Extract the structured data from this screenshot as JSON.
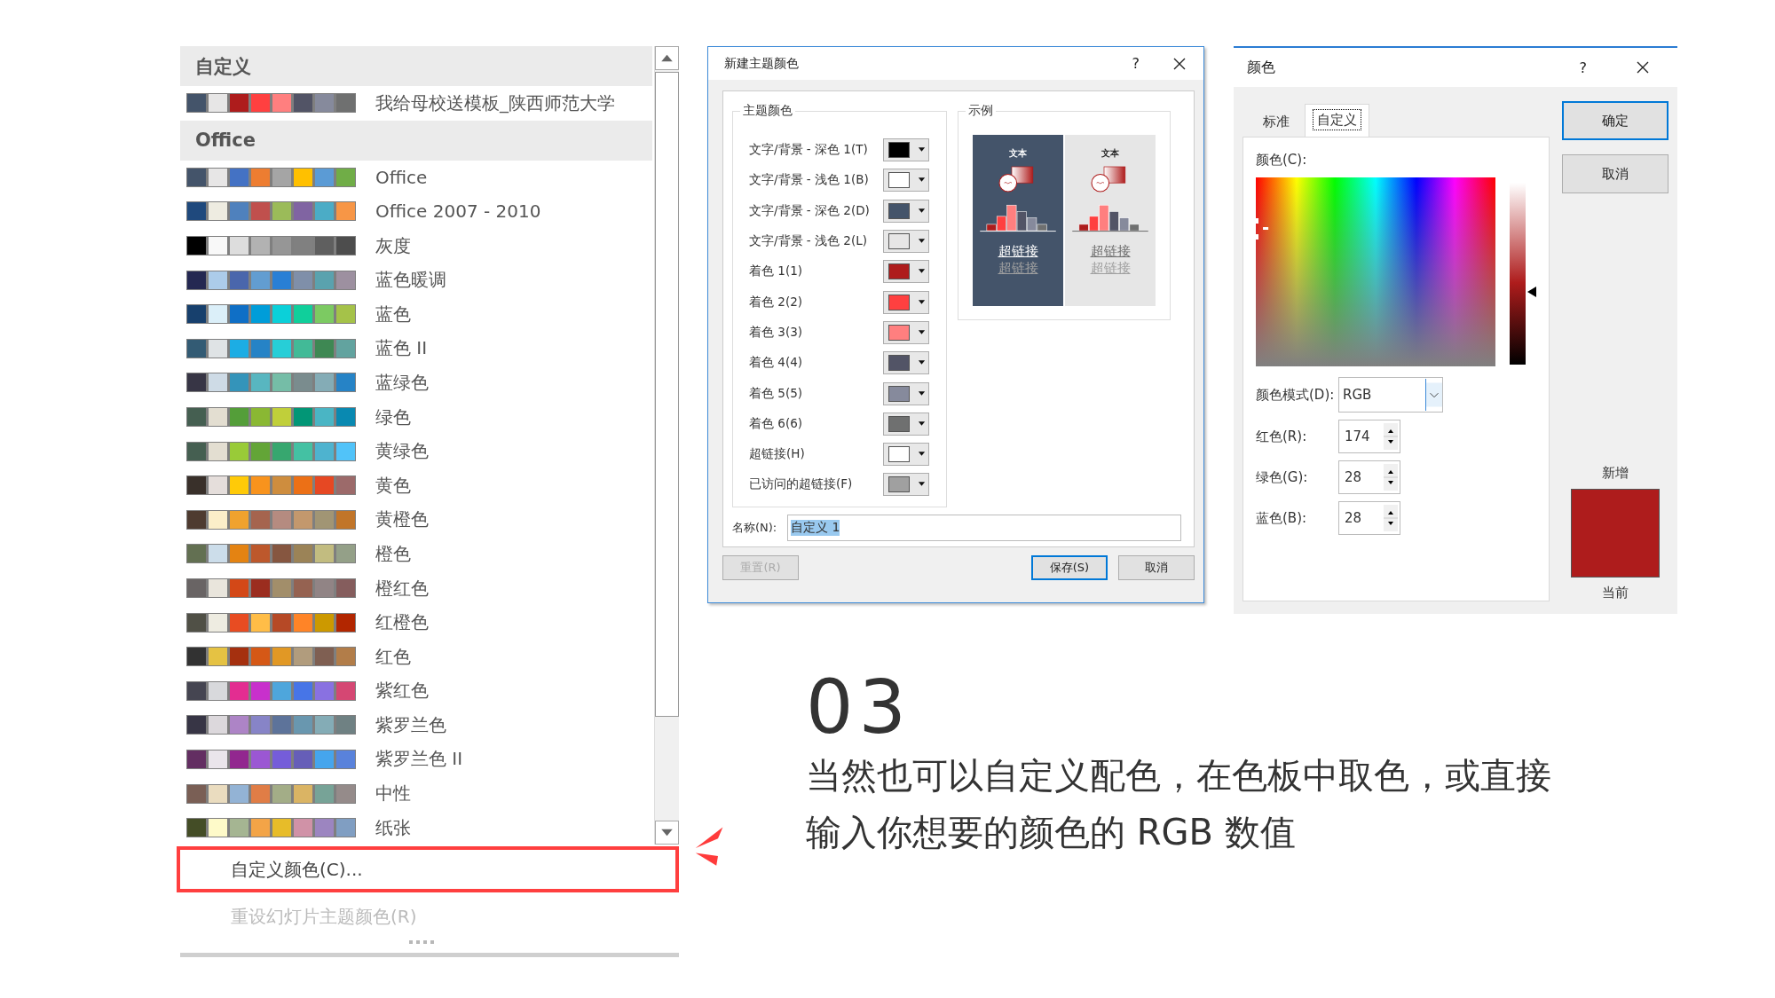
{
  "theme_menu": {
    "sections": [
      {
        "title": "自定义",
        "themes": [
          {
            "name": "我给母校送模板_陕西师范大学",
            "colors": [
              {
                "color": "#44546a"
              },
              {
                "color": "#e7e6e6"
              },
              {
                "color": "#ae1c1c"
              },
              {
                "color": "#ff4040"
              },
              {
                "color": "#ff7f7f"
              },
              {
                "color": "#525466"
              },
              {
                "color": "#868a9c"
              },
              {
                "color": "#6f7070"
              }
            ]
          }
        ]
      },
      {
        "title": "Office",
        "themes": [
          {
            "name": "Office",
            "colors": [
              {
                "color": "#44546a"
              },
              {
                "color": "#e7e6e6"
              },
              {
                "color": "#4472c4"
              },
              {
                "color": "#ed7d31"
              },
              {
                "color": "#a5a5a5"
              },
              {
                "color": "#ffc000"
              },
              {
                "color": "#5b9bd5"
              },
              {
                "color": "#70ad47"
              }
            ]
          },
          {
            "name": "Office 2007 - 2010",
            "colors": [
              {
                "color": "#1f497d"
              },
              {
                "color": "#eeece1"
              },
              {
                "color": "#4f81bd"
              },
              {
                "color": "#c0504d"
              },
              {
                "color": "#9bbb59"
              },
              {
                "color": "#8064a2"
              },
              {
                "color": "#4bacc6"
              },
              {
                "color": "#f79646"
              }
            ]
          },
          {
            "name": "灰度",
            "colors": [
              {
                "color": "#000000"
              },
              {
                "color": "#f8f8f8"
              },
              {
                "color": "#dddddd"
              },
              {
                "color": "#b2b2b2"
              },
              {
                "color": "#969696"
              },
              {
                "color": "#808080"
              },
              {
                "color": "#5f5f5f"
              },
              {
                "color": "#4d4d4d"
              }
            ]
          },
          {
            "name": "蓝色暖调",
            "colors": [
              {
                "color": "#242852"
              },
              {
                "color": "#acccea"
              },
              {
                "color": "#4a66ac"
              },
              {
                "color": "#629dd1"
              },
              {
                "color": "#297fd5"
              },
              {
                "color": "#7f8fa9"
              },
              {
                "color": "#5aa2ae"
              },
              {
                "color": "#9d90a0"
              }
            ]
          },
          {
            "name": "蓝色",
            "colors": [
              {
                "color": "#17406d"
              },
              {
                "color": "#dbeff9"
              },
              {
                "color": "#0f6fc6"
              },
              {
                "color": "#009dd9"
              },
              {
                "color": "#0bd0d9"
              },
              {
                "color": "#10cf9b"
              },
              {
                "color": "#7cca62"
              },
              {
                "color": "#a5c249"
              }
            ]
          },
          {
            "name": "蓝色 II",
            "colors": [
              {
                "color": "#335b74"
              },
              {
                "color": "#dfe3e5"
              },
              {
                "color": "#1cade4"
              },
              {
                "color": "#2683c6"
              },
              {
                "color": "#27ced7"
              },
              {
                "color": "#42ba97"
              },
              {
                "color": "#3e8853"
              },
              {
                "color": "#62a39f"
              }
            ]
          },
          {
            "name": "蓝绿色",
            "colors": [
              {
                "color": "#373545"
              },
              {
                "color": "#cedbe6"
              },
              {
                "color": "#3494ba"
              },
              {
                "color": "#58b6c0"
              },
              {
                "color": "#75bda7"
              },
              {
                "color": "#7a8c8e"
              },
              {
                "color": "#84acb6"
              },
              {
                "color": "#2683c6"
              }
            ]
          },
          {
            "name": "绿色",
            "colors": [
              {
                "color": "#455f51"
              },
              {
                "color": "#e3ded1"
              },
              {
                "color": "#549e39"
              },
              {
                "color": "#8ab833"
              },
              {
                "color": "#c0cf3a"
              },
              {
                "color": "#029676"
              },
              {
                "color": "#4ab5c4"
              },
              {
                "color": "#0989b1"
              }
            ]
          },
          {
            "name": "黄绿色",
            "colors": [
              {
                "color": "#455f51"
              },
              {
                "color": "#e3ded1"
              },
              {
                "color": "#99cb38"
              },
              {
                "color": "#63a537"
              },
              {
                "color": "#37a76f"
              },
              {
                "color": "#44c1a3"
              },
              {
                "color": "#4eb3cf"
              },
              {
                "color": "#51c3f9"
              }
            ]
          },
          {
            "name": "黄色",
            "colors": [
              {
                "color": "#39302a"
              },
              {
                "color": "#e5dedb"
              },
              {
                "color": "#ffca08"
              },
              {
                "color": "#f8931d"
              },
              {
                "color": "#ce8d3e"
              },
              {
                "color": "#ec7016"
              },
              {
                "color": "#e64823"
              },
              {
                "color": "#9c6a6a"
              }
            ]
          },
          {
            "name": "黄橙色",
            "colors": [
              {
                "color": "#4e3b30"
              },
              {
                "color": "#fbeec9"
              },
              {
                "color": "#f0a22e"
              },
              {
                "color": "#a5644e"
              },
              {
                "color": "#b58b80"
              },
              {
                "color": "#c3986d"
              },
              {
                "color": "#a19574"
              },
              {
                "color": "#c17529"
              }
            ]
          },
          {
            "name": "橙色",
            "colors": [
              {
                "color": "#637052"
              },
              {
                "color": "#ccddea"
              },
              {
                "color": "#e48312"
              },
              {
                "color": "#bd582c"
              },
              {
                "color": "#865640"
              },
              {
                "color": "#9b8357"
              },
              {
                "color": "#c2bc80"
              },
              {
                "color": "#94a088"
              }
            ]
          },
          {
            "name": "橙红色",
            "colors": [
              {
                "color": "#696464"
              },
              {
                "color": "#e9e5dc"
              },
              {
                "color": "#d34817"
              },
              {
                "color": "#9b2d1f"
              },
              {
                "color": "#a28e6a"
              },
              {
                "color": "#956251"
              },
              {
                "color": "#918485"
              },
              {
                "color": "#855d5d"
              }
            ]
          },
          {
            "name": "红橙色",
            "colors": [
              {
                "color": "#505046"
              },
              {
                "color": "#eeece1"
              },
              {
                "color": "#e84c22"
              },
              {
                "color": "#ffbd47"
              },
              {
                "color": "#b64926"
              },
              {
                "color": "#ff8427"
              },
              {
                "color": "#cc9900"
              },
              {
                "color": "#b22600"
              }
            ]
          },
          {
            "name": "红色",
            "colors": [
              {
                "color": "#323232"
              },
              {
                "color": "#e5c243"
              },
              {
                "color": "#a5300f"
              },
              {
                "color": "#d55816"
              },
              {
                "color": "#e19825"
              },
              {
                "color": "#b19c7d"
              },
              {
                "color": "#7f5f52"
              },
              {
                "color": "#b27d49"
              }
            ]
          },
          {
            "name": "紫红色",
            "colors": [
              {
                "color": "#454551"
              },
              {
                "color": "#d8d9dc"
              },
              {
                "color": "#e32d91"
              },
              {
                "color": "#c830cc"
              },
              {
                "color": "#4ea6dc"
              },
              {
                "color": "#4775e7"
              },
              {
                "color": "#8971e1"
              },
              {
                "color": "#d54773"
              }
            ]
          },
          {
            "name": "紫罗兰色",
            "colors": [
              {
                "color": "#373545"
              },
              {
                "color": "#dcd8dc"
              },
              {
                "color": "#ad84c6"
              },
              {
                "color": "#8784c7"
              },
              {
                "color": "#5d739a"
              },
              {
                "color": "#6997af"
              },
              {
                "color": "#84acb6"
              },
              {
                "color": "#6f8183"
              }
            ]
          },
          {
            "name": "紫罗兰色 II",
            "colors": [
              {
                "color": "#632e62"
              },
              {
                "color": "#eae5eb"
              },
              {
                "color": "#92278f"
              },
              {
                "color": "#9b57d3"
              },
              {
                "color": "#755dd9"
              },
              {
                "color": "#665eb8"
              },
              {
                "color": "#45a5ed"
              },
              {
                "color": "#5982db"
              }
            ]
          },
          {
            "name": "中性",
            "colors": [
              {
                "color": "#7a5f55"
              },
              {
                "color": "#eadcbf"
              },
              {
                "color": "#93b3d5"
              },
              {
                "color": "#e07d46"
              },
              {
                "color": "#a3ad87"
              },
              {
                "color": "#dab464"
              },
              {
                "color": "#77a397"
              },
              {
                "color": "#958b8a"
              }
            ]
          },
          {
            "name": "纸张",
            "colors": [
              {
                "color": "#444d26"
              },
              {
                "color": "#fefac9"
              },
              {
                "color": "#a5b592"
              },
              {
                "color": "#f3a447"
              },
              {
                "color": "#e7bc29"
              },
              {
                "color": "#d092a7"
              },
              {
                "color": "#9c85c0"
              },
              {
                "color": "#809ec2"
              }
            ]
          }
        ]
      }
    ],
    "actions": [
      {
        "label": "自定义颜色(C)...",
        "highlighted": true,
        "disabled": false
      },
      {
        "label": "重设幻灯片主题颜色(R)",
        "highlighted": false,
        "disabled": true
      }
    ]
  },
  "new_theme_dialog": {
    "title": "新建主题颜色",
    "help": "?",
    "group_title": "主题颜色",
    "rows": [
      {
        "label": "文字/背景 - 深色 1(T)",
        "color": "#000000"
      },
      {
        "label": "文字/背景 - 浅色 1(B)",
        "color": "#ffffff"
      },
      {
        "label": "文字/背景 - 深色 2(D)",
        "color": "#44546a"
      },
      {
        "label": "文字/背景 - 浅色 2(L)",
        "color": "#e7e6e6"
      },
      {
        "label": "着色 1(1)",
        "color": "#ae1c1c"
      },
      {
        "label": "着色 2(2)",
        "color": "#ff4040"
      },
      {
        "label": "着色 3(3)",
        "color": "#ff7f7f"
      },
      {
        "label": "着色 4(4)",
        "color": "#525466"
      },
      {
        "label": "着色 5(5)",
        "color": "#868a9c"
      },
      {
        "label": "着色 6(6)",
        "color": "#6f7070"
      },
      {
        "label": "超链接(H)",
        "color": "#ffffff"
      },
      {
        "label": "已访问的超链接(F)",
        "color": "#a0a0a0"
      }
    ],
    "sample_title": "示例",
    "samples": [
      {
        "text": "文本",
        "link": "超链接",
        "visited": "超链接",
        "dark": true
      },
      {
        "text": "文本",
        "link": "超链接",
        "visited": "超链接",
        "dark": false
      }
    ],
    "name_label": "名称(N):",
    "name_value": "自定义 1",
    "name_selected": true,
    "buttons": [
      {
        "label": "重置(R)",
        "disabled": true,
        "default": false
      },
      {
        "label": "保存(S)",
        "disabled": false,
        "default": true
      },
      {
        "label": "取消",
        "disabled": false,
        "default": false
      }
    ]
  },
  "color_dialog": {
    "title": "颜色",
    "help": "?",
    "tabs": [
      {
        "label": "标准",
        "selected": false
      },
      {
        "label": "自定义",
        "selected": true
      }
    ],
    "spectrum_label": "颜色(C):",
    "luminance": {
      "level": 0.4
    },
    "mode_label": "颜色模式(D):",
    "mode_value": "RGB",
    "fields": [
      {
        "label": "红色(R):",
        "value": "174"
      },
      {
        "label": "绿色(G):",
        "value": "28"
      },
      {
        "label": "蓝色(B):",
        "value": "28"
      }
    ],
    "buttons": [
      {
        "label": "确定",
        "default": true
      },
      {
        "label": "取消",
        "default": false
      }
    ],
    "new_label": "新增",
    "current": {
      "color": "#ae1c1c"
    },
    "current_label": "当前"
  },
  "caption": {
    "number": "03",
    "lines": [
      "当然也可以自定义配色，在色板中取色，或直接",
      "输入你想要的颜色的 RGB 数值"
    ]
  }
}
